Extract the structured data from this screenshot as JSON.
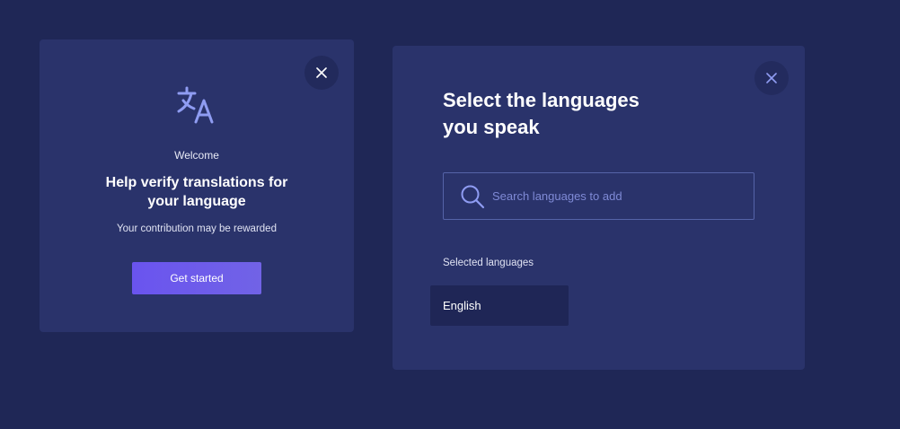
{
  "welcome_card": {
    "label": "Welcome",
    "title_line1": "Help verify translations for",
    "title_line2": "your language",
    "subtitle": "Your contribution may be rewarded",
    "cta_label": "Get started",
    "icon": "translate-icon",
    "close_icon": "close-icon"
  },
  "language_card": {
    "title_line1": "Select the languages",
    "title_line2": "you speak",
    "search": {
      "placeholder": "Search languages to add",
      "value": "",
      "icon": "search-icon"
    },
    "selected_label": "Selected languages",
    "selected_languages": [
      "English"
    ],
    "close_icon": "close-icon"
  },
  "colors": {
    "background": "#1f2756",
    "card": "#2a336b",
    "accent": "#6a54ef",
    "icon": "#8f9cf2",
    "placeholder": "#7f8ad6"
  }
}
